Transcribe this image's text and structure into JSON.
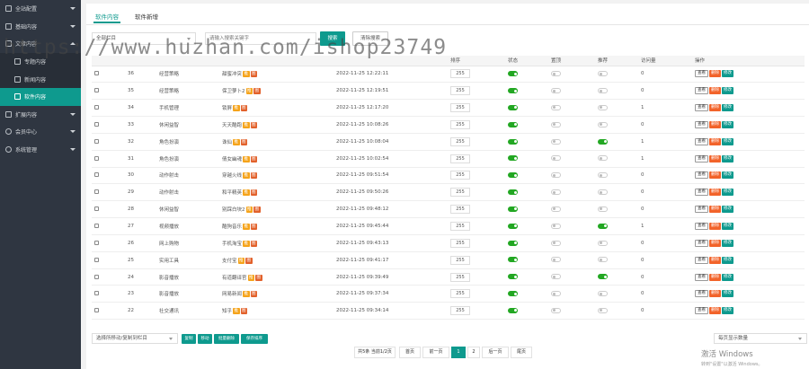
{
  "sidebar": {
    "items": [
      {
        "label": "全站配置"
      },
      {
        "label": "基础内容"
      },
      {
        "label": "文章内容"
      },
      {
        "label": "专题内容"
      },
      {
        "label": "新闻内容"
      },
      {
        "label": "软件内容"
      },
      {
        "label": "扩展内容"
      },
      {
        "label": "会员中心"
      },
      {
        "label": "系统管理"
      }
    ]
  },
  "tabs": [
    {
      "label": "软件内容"
    },
    {
      "label": "软件新增"
    }
  ],
  "filter": {
    "column_select": "全部栏目",
    "search_placeholder": "请输入搜索关键字",
    "search_button": "搜索",
    "clear_button": "清除搜索"
  },
  "table": {
    "headers": [
      "",
      "",
      "",
      "",
      "",
      "排序",
      "状态",
      "置顶",
      "推荐",
      "访问量",
      "操作"
    ],
    "rows": [
      {
        "id": "36",
        "column": "经营策略",
        "title": "甜蜜冲突",
        "tags": [
          "推",
          "图"
        ],
        "time": "2022-11-25 12:22:11",
        "sort": "255",
        "status": true,
        "top": false,
        "rec": false,
        "visits": "0"
      },
      {
        "id": "35",
        "column": "经营策略",
        "title": "保卫萝卜2",
        "tags": [
          "推",
          "图"
        ],
        "time": "2022-11-25 12:19:51",
        "sort": "255",
        "status": true,
        "top": false,
        "rec": false,
        "visits": "0"
      },
      {
        "id": "34",
        "column": "手机管理",
        "title": "锁屏",
        "tags": [
          "推",
          "图"
        ],
        "time": "2022-11-25 12:17:20",
        "sort": "255",
        "status": true,
        "top": false,
        "rec": false,
        "visits": "1"
      },
      {
        "id": "33",
        "column": "休闲益智",
        "title": "天天酷跑",
        "tags": [
          "推",
          "图"
        ],
        "time": "2022-11-25 10:08:26",
        "sort": "255",
        "status": true,
        "top": false,
        "rec": false,
        "visits": "0"
      },
      {
        "id": "32",
        "column": "角色扮演",
        "title": "诛仙",
        "tags": [
          "推",
          "图"
        ],
        "time": "2022-11-25 10:08:04",
        "sort": "255",
        "status": true,
        "top": false,
        "rec": true,
        "visits": "1"
      },
      {
        "id": "31",
        "column": "角色扮演",
        "title": "倩女幽魂",
        "tags": [
          "推",
          "图"
        ],
        "time": "2022-11-25 10:02:54",
        "sort": "255",
        "status": true,
        "top": false,
        "rec": false,
        "visits": "1"
      },
      {
        "id": "30",
        "column": "动作射击",
        "title": "穿越火线",
        "tags": [
          "推",
          "图"
        ],
        "time": "2022-11-25 09:51:54",
        "sort": "255",
        "status": true,
        "top": false,
        "rec": false,
        "visits": "0"
      },
      {
        "id": "29",
        "column": "动作射击",
        "title": "和平精英",
        "tags": [
          "推",
          "图"
        ],
        "time": "2022-11-25 09:50:26",
        "sort": "255",
        "status": true,
        "top": false,
        "rec": false,
        "visits": "0"
      },
      {
        "id": "28",
        "column": "休闲益智",
        "title": "别踩白块2",
        "tags": [
          "推",
          "图"
        ],
        "time": "2022-11-25 09:48:12",
        "sort": "255",
        "status": true,
        "top": false,
        "rec": false,
        "visits": "0"
      },
      {
        "id": "27",
        "column": "视频播放",
        "title": "酷狗音乐",
        "tags": [
          "推",
          "图"
        ],
        "time": "2022-11-25 09:45:44",
        "sort": "255",
        "status": true,
        "top": false,
        "rec": true,
        "visits": "1"
      },
      {
        "id": "26",
        "column": "网上购物",
        "title": "手机淘宝",
        "tags": [
          "推",
          "图"
        ],
        "time": "2022-11-25 09:43:13",
        "sort": "255",
        "status": true,
        "top": false,
        "rec": false,
        "visits": "0"
      },
      {
        "id": "25",
        "column": "实用工具",
        "title": "支付宝",
        "tags": [
          "推",
          "图"
        ],
        "time": "2022-11-25 09:41:17",
        "sort": "255",
        "status": true,
        "top": false,
        "rec": false,
        "visits": "0"
      },
      {
        "id": "24",
        "column": "影音播放",
        "title": "有道翻译官",
        "tags": [
          "推",
          "图"
        ],
        "time": "2022-11-25 09:39:49",
        "sort": "255",
        "status": true,
        "top": false,
        "rec": true,
        "visits": "0"
      },
      {
        "id": "23",
        "column": "影音播放",
        "title": "网易新闻",
        "tags": [
          "推",
          "图"
        ],
        "time": "2022-11-25 09:37:34",
        "sort": "255",
        "status": true,
        "top": false,
        "rec": false,
        "visits": "0"
      },
      {
        "id": "22",
        "column": "社交通讯",
        "title": "知乎",
        "tags": [
          "推",
          "图"
        ],
        "time": "2022-11-25 09:34:14",
        "sort": "255",
        "status": true,
        "top": false,
        "rec": false,
        "visits": "0"
      }
    ],
    "ops": {
      "view": "查看",
      "delete": "删除",
      "edit": "修改"
    }
  },
  "bottom": {
    "move_select": "选择所移动/复制到栏目",
    "buttons": [
      "复制",
      "移动",
      "批量删除",
      "保存排序"
    ],
    "page_size_select": "每页显示数量"
  },
  "pager": {
    "info": "共5条 当前1/2页",
    "first": "首页",
    "prev": "前一页",
    "pages": [
      "1",
      "2"
    ],
    "next": "后一页",
    "last": "尾页"
  },
  "watermark": "https://www.huzhan.com/ishop23749",
  "activation": {
    "title": "激活 Windows",
    "subtitle": "转到\"设置\"以激活 Windows。"
  }
}
